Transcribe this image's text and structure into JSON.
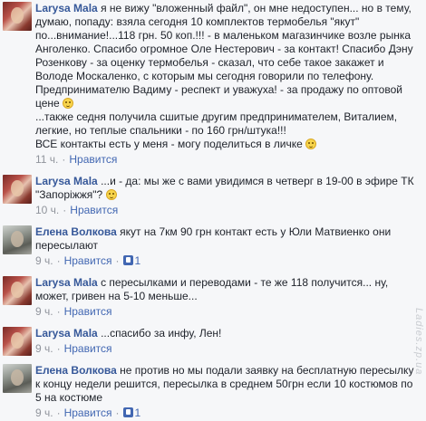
{
  "comments": [
    {
      "author": "Larysa Mala",
      "text_a": "я не вижу \"вложенный файл\", он мне недоступен... но в тему, думаю, попаду: взяла сегодня 10 комплектов термобелья \"якут\" по...внимание!...118 грн. 50 коп.!!! - в маленьком магазинчике возле рынка Анголенко. Спасибо огромное Оле Нестерович - за контакт! Спасибо Дэну Розенкову - за оценку термобелья - сказал, что себе такое закажет и Володе Москаленко, с которым мы сегодня говорили по телефону. Предпринимателю Вадиму - респект и уважуха! - за продажу по оптовой цене",
      "text_b": "...также седня получила сшитые другим предпринимателем, Виталием, легкие, но теплые спальники - по 160 грн/штука!!!",
      "text_c": "ВСЕ контакты есть у меня - могу поделиться в личке",
      "time": "11 ч.",
      "like": "Нравится"
    },
    {
      "author": "Larysa Mala",
      "text": "...и - да: мы же с вами увидимся в четверг в 19-00 в эфире ТК \"Запоріжжя\"?",
      "time": "10 ч.",
      "like": "Нравится"
    },
    {
      "author": "Елена Волкова",
      "text": "якут на 7км 90 грн контакт есть у Юли Матвиенко они пересылают",
      "time": "9 ч.",
      "like": "Нравится",
      "likes": "1"
    },
    {
      "author": "Larysa Mala",
      "text": "с пересылками и переводами - те же 118 получится... ну, может, гривен на 5-10 меньше...",
      "time": "9 ч.",
      "like": "Нравится"
    },
    {
      "author": "Larysa Mala",
      "text": "...спасибо за инфу, Лен!",
      "time": "9 ч.",
      "like": "Нравится"
    },
    {
      "author": "Елена Волкова",
      "text": "не против но мы подали заявку на бесплатную пересылку к концу недели решится, пересылка в среднем 50грн если 10 костюмов по 5 на костюме",
      "time": "9 ч.",
      "like": "Нравится",
      "likes": "1"
    }
  ],
  "watermark": "Ladies.zp.ua",
  "icons": {
    "emoji": "smile-emoji-icon",
    "like": "thumbs-up-icon"
  },
  "colors": {
    "author": "#365899",
    "like": "#4267b2",
    "meta": "#90949c",
    "background": "#f6f7f9"
  }
}
